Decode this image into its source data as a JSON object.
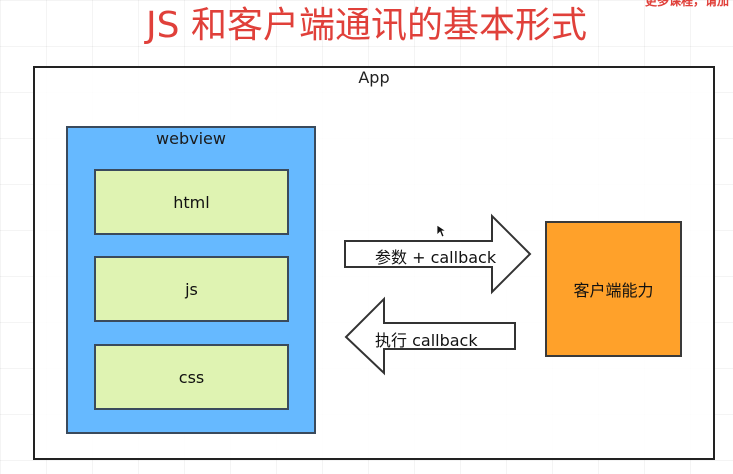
{
  "title": "JS 和客户端通讯的基本形式",
  "corner_note": "更多课程，请加",
  "app": {
    "label": "App"
  },
  "webview": {
    "label": "webview",
    "items": [
      "html",
      "js",
      "css"
    ]
  },
  "native": {
    "label": "客户端能力"
  },
  "arrows": {
    "to_native": "参数 + callback",
    "to_webview": "执行 callback"
  },
  "colors": {
    "title": "#e0403a",
    "webview_fill": "#66b9ff",
    "item_fill": "#dff3b2",
    "native_fill": "#ffa12a"
  }
}
